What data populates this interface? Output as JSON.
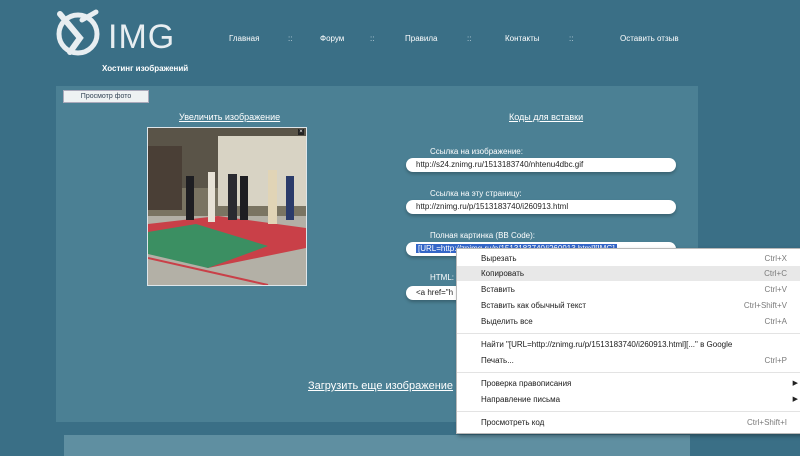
{
  "header": {
    "logo_text": "IMG",
    "logo_subtitle": "Хостинг изображений",
    "nav": [
      "Главная",
      "Форум",
      "Правила",
      "Контакты",
      "Оставить отзыв"
    ],
    "separator": "::"
  },
  "tab_label": "Просмотр фото",
  "enlarge_link": "Увеличить изображение",
  "codes_link": "Коды для вставки",
  "fields": [
    {
      "label": "Ссылка на изображение:",
      "value": "http://s24.znimg.ru/1513183740/nhtenu4dbc.gif"
    },
    {
      "label": "Ссылка на эту страницу:",
      "value": "http://znimg.ru/p/1513183740/i260913.html"
    },
    {
      "label": "Полная картинка (BB Code):",
      "value": "[URL=http://znimg.ru/p/1513183740/i260913.html][IMG]"
    },
    {
      "label": "HTML:",
      "value": "<a href=\"h"
    }
  ],
  "upload_link": "Загрузить еще изображение",
  "context_menu": {
    "items": [
      {
        "label": "Вырезать",
        "shortcut": "Ctrl+X"
      },
      {
        "label": "Копировать",
        "shortcut": "Ctrl+C",
        "highlighted": true
      },
      {
        "label": "Вставить",
        "shortcut": "Ctrl+V"
      },
      {
        "label": "Вставить как обычный текст",
        "shortcut": "Ctrl+Shift+V"
      },
      {
        "label": "Выделить все",
        "shortcut": "Ctrl+A"
      },
      {
        "label": "Найти \"[URL=http://znimg.ru/p/1513183740/i260913.html][...\" в Google",
        "shortcut": ""
      },
      {
        "label": "Печать...",
        "shortcut": "Ctrl+P"
      },
      {
        "label": "Проверка правописания",
        "shortcut": "",
        "submenu": true
      },
      {
        "label": "Направление письма",
        "shortcut": "",
        "submenu": true
      },
      {
        "label": "Просмотреть код",
        "shortcut": "Ctrl+Shift+I"
      }
    ]
  },
  "colors": {
    "background": "#3a6f86",
    "panel": "#4b8094",
    "selection": "#3466c8"
  }
}
